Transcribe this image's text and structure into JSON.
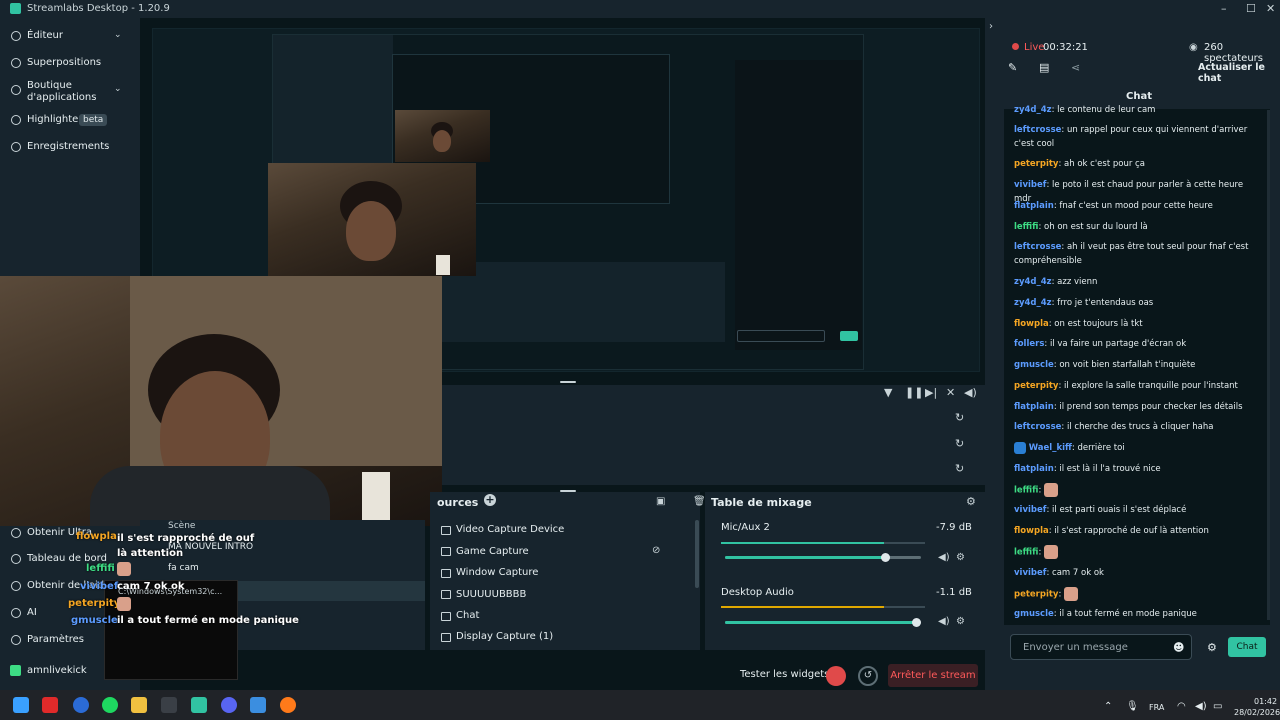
{
  "titlebar": {
    "title": "Streamlabs Desktop - 1.20.9",
    "minimize": "–",
    "maximize": "☐",
    "close": "✕"
  },
  "sidebar": {
    "items": [
      {
        "label": "Éditeur",
        "icon": "editor-icon",
        "chevron": "⌄"
      },
      {
        "label": "Superpositions",
        "icon": "overlays-icon"
      },
      {
        "label": "Boutique d'applications",
        "icon": "app-store-icon",
        "chevron": "⌄"
      },
      {
        "label": "Highlighter",
        "icon": "highlighter-icon",
        "badge": "beta"
      },
      {
        "label": "Enregistrements",
        "icon": "recordings-icon"
      }
    ],
    "bottom": [
      {
        "label": "Obtenir Ultra",
        "icon": "ultra-icon"
      },
      {
        "label": "Tableau de bord",
        "icon": "dashboard-icon"
      },
      {
        "label": "Obtenir de l'aide",
        "icon": "help-icon"
      },
      {
        "label": "AI",
        "icon": "ai-icon"
      },
      {
        "label": "Paramètres",
        "icon": "settings-icon"
      },
      {
        "label": "amnlivekick",
        "icon": "kick-icon"
      }
    ]
  },
  "scenes": {
    "title": "Scène",
    "items": [
      "MA NOUVEL INTRO",
      "fa cam",
      "C:\\Windows\\System32\\c..."
    ]
  },
  "sources": {
    "title": "ources",
    "items": [
      "Video Capture Device",
      "Game Capture",
      "Window Capture",
      "SUUUUUBBBB",
      "Chat",
      "Display Capture (1)"
    ]
  },
  "mixer": {
    "title": "Table de mixage",
    "channels": [
      {
        "name": "Mic/Aux 2",
        "db": "-7.9 dB",
        "level": 0.82
      },
      {
        "name": "Desktop Audio",
        "db": "-1.1 dB",
        "level": 0.98
      }
    ]
  },
  "footer": {
    "test_widgets": "Tester les widgets",
    "stop_stream": "Arrêter le stream"
  },
  "live": {
    "status": "Live",
    "time": "00:32:21",
    "viewers": "260 spectateurs",
    "refresh_chat": "Actualiser le chat"
  },
  "chat": {
    "title": "Chat",
    "input_placeholder": "Envoyer un message",
    "send_label": "Chat",
    "messages": [
      {
        "user": "zy4d_4z",
        "text": ": le contenu de leur cam",
        "color": "#5c9cff"
      },
      {
        "user": "leftcrosse",
        "text": ": un rappel pour ceux qui viennent d'arriver c'est cool",
        "color": "#5c9cff"
      },
      {
        "user": "peterpity",
        "text": ": ah ok c'est pour ça",
        "color": "#f5a623"
      },
      {
        "user": "vivibef",
        "text": ": le poto il est chaud pour parler à cette heure mdr",
        "color": "#5c9cff"
      },
      {
        "user": "flatplain",
        "text": ": fnaf c'est un mood pour cette heure",
        "color": "#5c9cff"
      },
      {
        "user": "leffifi",
        "text": ": oh on est sur du lourd là",
        "color": "#3ddc84"
      },
      {
        "user": "leftcrosse",
        "text": ": ah il veut pas être tout seul pour fnaf c'est compréhensible",
        "color": "#5c9cff"
      },
      {
        "user": "zy4d_4z",
        "text": ": azz vienn",
        "color": "#5c9cff"
      },
      {
        "user": "zy4d_4z",
        "text": ": frro je t'entendaus oas",
        "color": "#5c9cff"
      },
      {
        "user": "flowpla",
        "text": ": on est toujours là tkt",
        "color": "#f5a623"
      },
      {
        "user": "follers",
        "text": ": il va faire un partage d'écran ok",
        "color": "#5c9cff"
      },
      {
        "user": "gmuscle",
        "text": ": on voit bien starfallah t'inquiète",
        "color": "#5c9cff"
      },
      {
        "user": "peterpity",
        "text": ": il explore la salle tranquille pour l'instant",
        "color": "#f5a623"
      },
      {
        "user": "flatplain",
        "text": ": il prend son temps pour checker les détails",
        "color": "#5c9cff"
      },
      {
        "user": "leftcrosse",
        "text": ": il cherche des trucs à cliquer haha",
        "color": "#5c9cff"
      },
      {
        "user": "Wael_kiff",
        "text": ": derrière toi",
        "color": "#5c9cff"
      },
      {
        "user": "flatplain",
        "text": ": il est là il l'a trouvé nice",
        "color": "#5c9cff"
      },
      {
        "user": "leffifi",
        "text": ":",
        "color": "#3ddc84",
        "emote": true
      },
      {
        "user": "vivibef",
        "text": ": il est parti ouais il s'est déplacé",
        "color": "#5c9cff"
      },
      {
        "user": "flowpla",
        "text": ": il s'est rapproché de ouf là attention",
        "color": "#f5a623"
      },
      {
        "user": "leffifi",
        "text": ":",
        "color": "#3ddc84",
        "emote": true
      },
      {
        "user": "vivibef",
        "text": ": cam 7 ok ok",
        "color": "#5c9cff"
      },
      {
        "user": "peterpity",
        "text": ":",
        "color": "#f5a623",
        "emote": true
      },
      {
        "user": "gmuscle",
        "text": ": il a tout fermé en mode panique",
        "color": "#5c9cff"
      }
    ]
  },
  "overlay_chat": [
    {
      "user": "flowpla",
      "text": "il s'est rapproché de ouf là attention",
      "color": "#f5a623"
    },
    {
      "user": "leffifi",
      "text": "",
      "color": "#3ddc84"
    },
    {
      "user": "vivibef",
      "text": "cam 7 ok ok",
      "color": "#5c9cff"
    },
    {
      "user": "peterpity",
      "text": "",
      "color": "#f5a623"
    },
    {
      "user": "gmuscle",
      "text": "il a tout fermé en mode panique",
      "color": "#5c9cff"
    }
  ],
  "taskbar": {
    "lang": "FRA",
    "time": "01:42",
    "date": "28/02/2026"
  },
  "colors": {
    "accent": "#31c3a2",
    "live_red": "#e04a4a",
    "panel": "#17242d",
    "bg": "#09161a"
  }
}
